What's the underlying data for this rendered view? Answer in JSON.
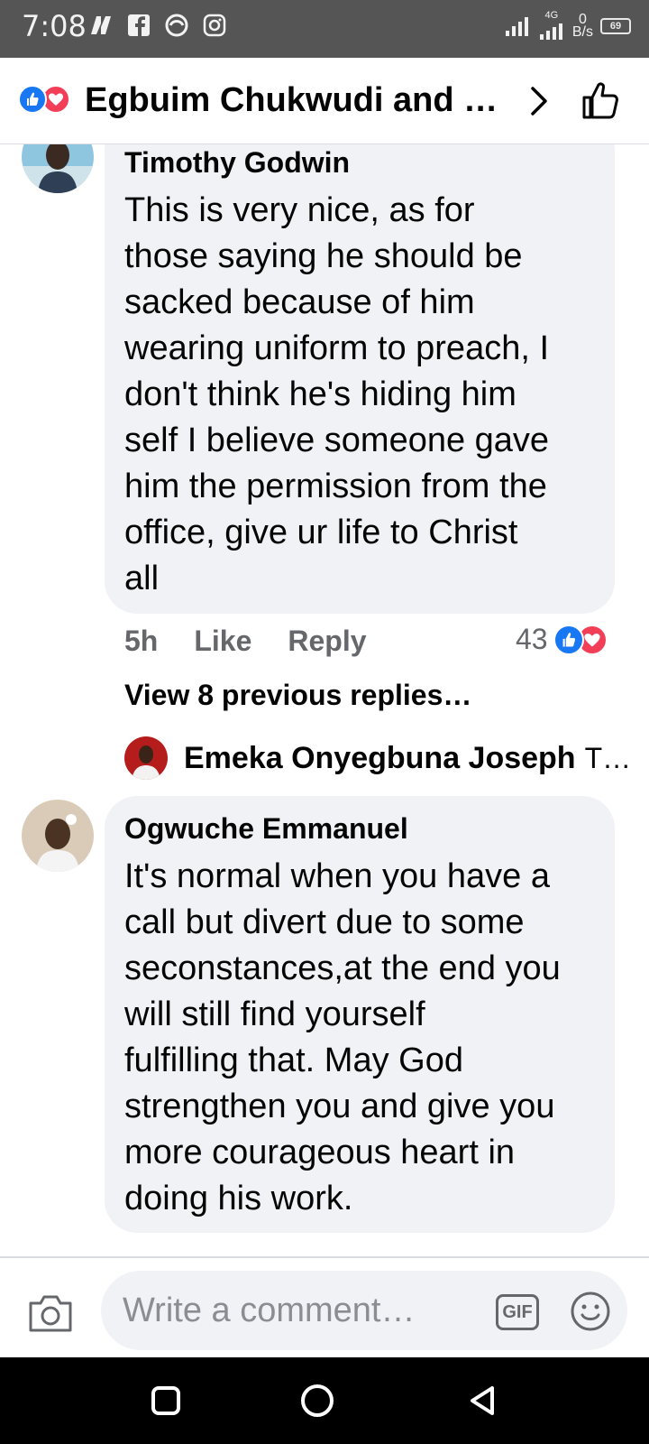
{
  "status_bar": {
    "time": "7:08",
    "network_type": "4G",
    "data_rate_value": "0",
    "data_rate_unit": "B/s",
    "battery": "69"
  },
  "header": {
    "title": "Egbuim Chukwudi and …",
    "reactions": [
      "like",
      "love"
    ]
  },
  "comments": [
    {
      "author": "Timothy Godwin",
      "text": "This is very nice, as for\nthose saying he should be\nsacked because of him\nwearing uniform to preach, I\ndon't think he's hiding him\nself I believe someone gave\nhim the permission from the\noffice, give ur life to Christ\nall",
      "time": "5h",
      "like_label": "Like",
      "reply_label": "Reply",
      "reaction_count": "43",
      "reactions": [
        "like",
        "love"
      ],
      "view_previous_replies": "View 8 previous replies…",
      "latest_reply": {
        "author": "Emeka Onyegbuna Joseph",
        "snippet": "T…"
      }
    },
    {
      "author": "Ogwuche Emmanuel",
      "text": "It's normal when you have a\ncall but divert due to some\nseconstances,at the end you\nwill still find yourself\nfulfilling that. May God\nstrengthen you and give you\nmore courageous heart in\ndoing his work."
    }
  ],
  "composer": {
    "placeholder": "Write a comment…",
    "gif_label": "GIF"
  },
  "colors": {
    "like_blue": "#1877f2",
    "love_red": "#f33e58",
    "bubble": "#f0f2f5",
    "secondary_text": "#65676b"
  }
}
